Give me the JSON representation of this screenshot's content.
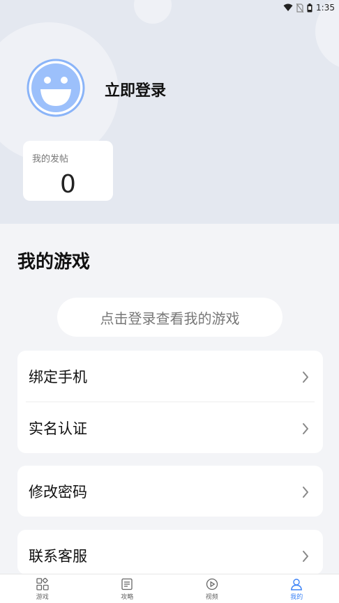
{
  "status_bar": {
    "time": "1:35",
    "icons": [
      "wifi-icon",
      "no-sim-icon",
      "battery-icon"
    ]
  },
  "profile": {
    "login_label": "立即登录",
    "avatar_icon": "smiley-avatar-icon"
  },
  "posts": {
    "label": "我的发帖",
    "count": "0"
  },
  "games": {
    "section_title": "我的游戏",
    "login_prompt": "点击登录查看我的游戏"
  },
  "menu": {
    "bind_phone": "绑定手机",
    "real_name": "实名认证",
    "change_password": "修改密码",
    "contact_service": "联系客服"
  },
  "tabs": [
    {
      "label": "游戏",
      "icon": "grid-icon",
      "active": false
    },
    {
      "label": "攻略",
      "icon": "news-icon",
      "active": false
    },
    {
      "label": "视频",
      "icon": "play-icon",
      "active": false
    },
    {
      "label": "我的",
      "icon": "person-icon",
      "active": true
    }
  ],
  "colors": {
    "accent": "#3b82f6",
    "header_bg": "#e4e8f0",
    "page_bg": "#f3f4f7"
  }
}
